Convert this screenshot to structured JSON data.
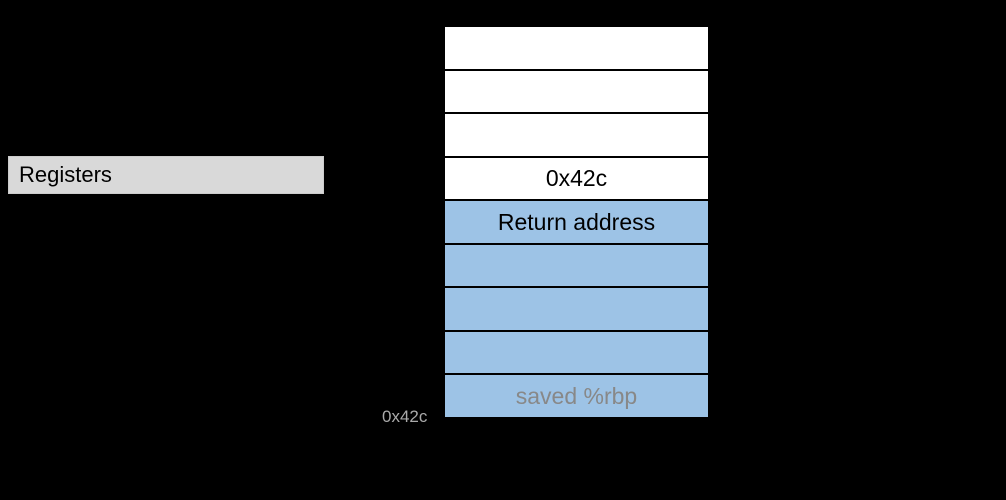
{
  "registers_label": "Registers",
  "addr_label": "0x42c",
  "cells": [
    {
      "text": "",
      "cls": "white"
    },
    {
      "text": "",
      "cls": "white"
    },
    {
      "text": "",
      "cls": "white"
    },
    {
      "text": "0x42c",
      "cls": "white"
    },
    {
      "text": "Return address",
      "cls": "blue"
    },
    {
      "text": "",
      "cls": "blue"
    },
    {
      "text": "",
      "cls": "blue"
    },
    {
      "text": "",
      "cls": "blue"
    },
    {
      "text": "saved %rbp",
      "cls": "blue faded"
    }
  ]
}
